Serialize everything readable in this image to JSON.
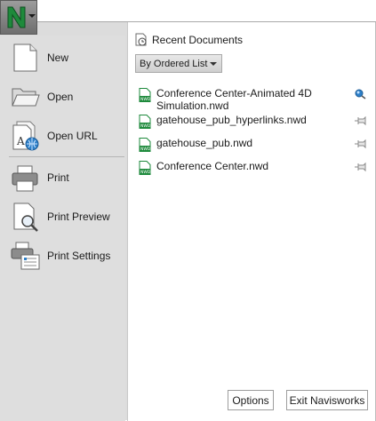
{
  "app_menu": {
    "logo_letter": "N",
    "icon": "navisworks-logo-icon"
  },
  "menu": {
    "items": [
      {
        "label": "New",
        "icon": "new-document-icon"
      },
      {
        "label": "Open",
        "icon": "folder-open-icon"
      },
      {
        "label": "Open URL",
        "icon": "open-url-icon"
      },
      {
        "label": "Print",
        "icon": "printer-icon"
      },
      {
        "label": "Print Preview",
        "icon": "print-preview-icon"
      },
      {
        "label": "Print Settings",
        "icon": "print-settings-icon"
      }
    ]
  },
  "recent": {
    "title": "Recent Documents",
    "order_label": "By Ordered List",
    "file_badge": "NWD",
    "documents": [
      {
        "name": "Conference Center-Animated 4D Simulation.nwd",
        "pin_state": "active"
      },
      {
        "name": "gatehouse_pub_hyperlinks.nwd",
        "pin_state": "unpinned"
      },
      {
        "name": "gatehouse_pub.nwd",
        "pin_state": "unpinned"
      },
      {
        "name": "Conference Center.nwd",
        "pin_state": "unpinned"
      }
    ]
  },
  "buttons": {
    "options": "Options",
    "exit": "Exit Navisworks"
  },
  "colors": {
    "accent_green": "#1e8a3c",
    "panel_gray": "#dedede"
  }
}
